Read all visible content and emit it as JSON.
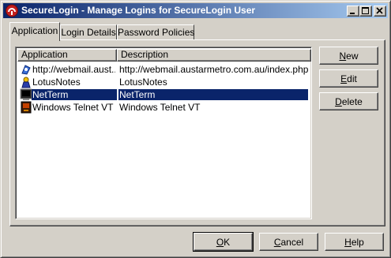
{
  "window": {
    "title": "SecureLogin - Manage Logins for SecureLogin User",
    "icon": "securelogin-logo-icon",
    "controls": [
      "minimize-icon",
      "maximize-icon",
      "close-icon"
    ]
  },
  "tabs": [
    {
      "label": "Application",
      "active": true
    },
    {
      "label": "Login Details",
      "active": false
    },
    {
      "label": "Password Policies",
      "active": false
    }
  ],
  "list": {
    "columns": [
      "Application",
      "Description"
    ],
    "rows": [
      {
        "application": "http://webmail.aust...",
        "description": "http://webmail.austarmetro.com.au/index.php",
        "icon": "web-app-icon",
        "selected": false
      },
      {
        "application": "LotusNotes",
        "description": "LotusNotes",
        "icon": "lotus-notes-icon",
        "selected": false
      },
      {
        "application": "NetTerm",
        "description": "NetTerm",
        "icon": "terminal-icon",
        "selected": true
      },
      {
        "application": "Windows Telnet VT",
        "description": "Windows Telnet VT",
        "icon": "telnet-icon",
        "selected": false
      }
    ]
  },
  "side_buttons": {
    "new": {
      "pre": "",
      "key": "N",
      "post": "ew"
    },
    "edit": {
      "pre": "",
      "key": "E",
      "post": "dit"
    },
    "delete": {
      "pre": "",
      "key": "D",
      "post": "elete"
    }
  },
  "bottom_buttons": {
    "ok": {
      "pre": "",
      "key": "O",
      "post": "K"
    },
    "cancel": {
      "pre": "",
      "key": "C",
      "post": "ancel"
    },
    "help": {
      "pre": "",
      "key": "H",
      "post": "elp"
    }
  },
  "colors": {
    "title_gradient_start": "#0a246a",
    "title_gradient_end": "#a6caf0",
    "selection": "#0a246a",
    "face": "#d4d0c8"
  }
}
